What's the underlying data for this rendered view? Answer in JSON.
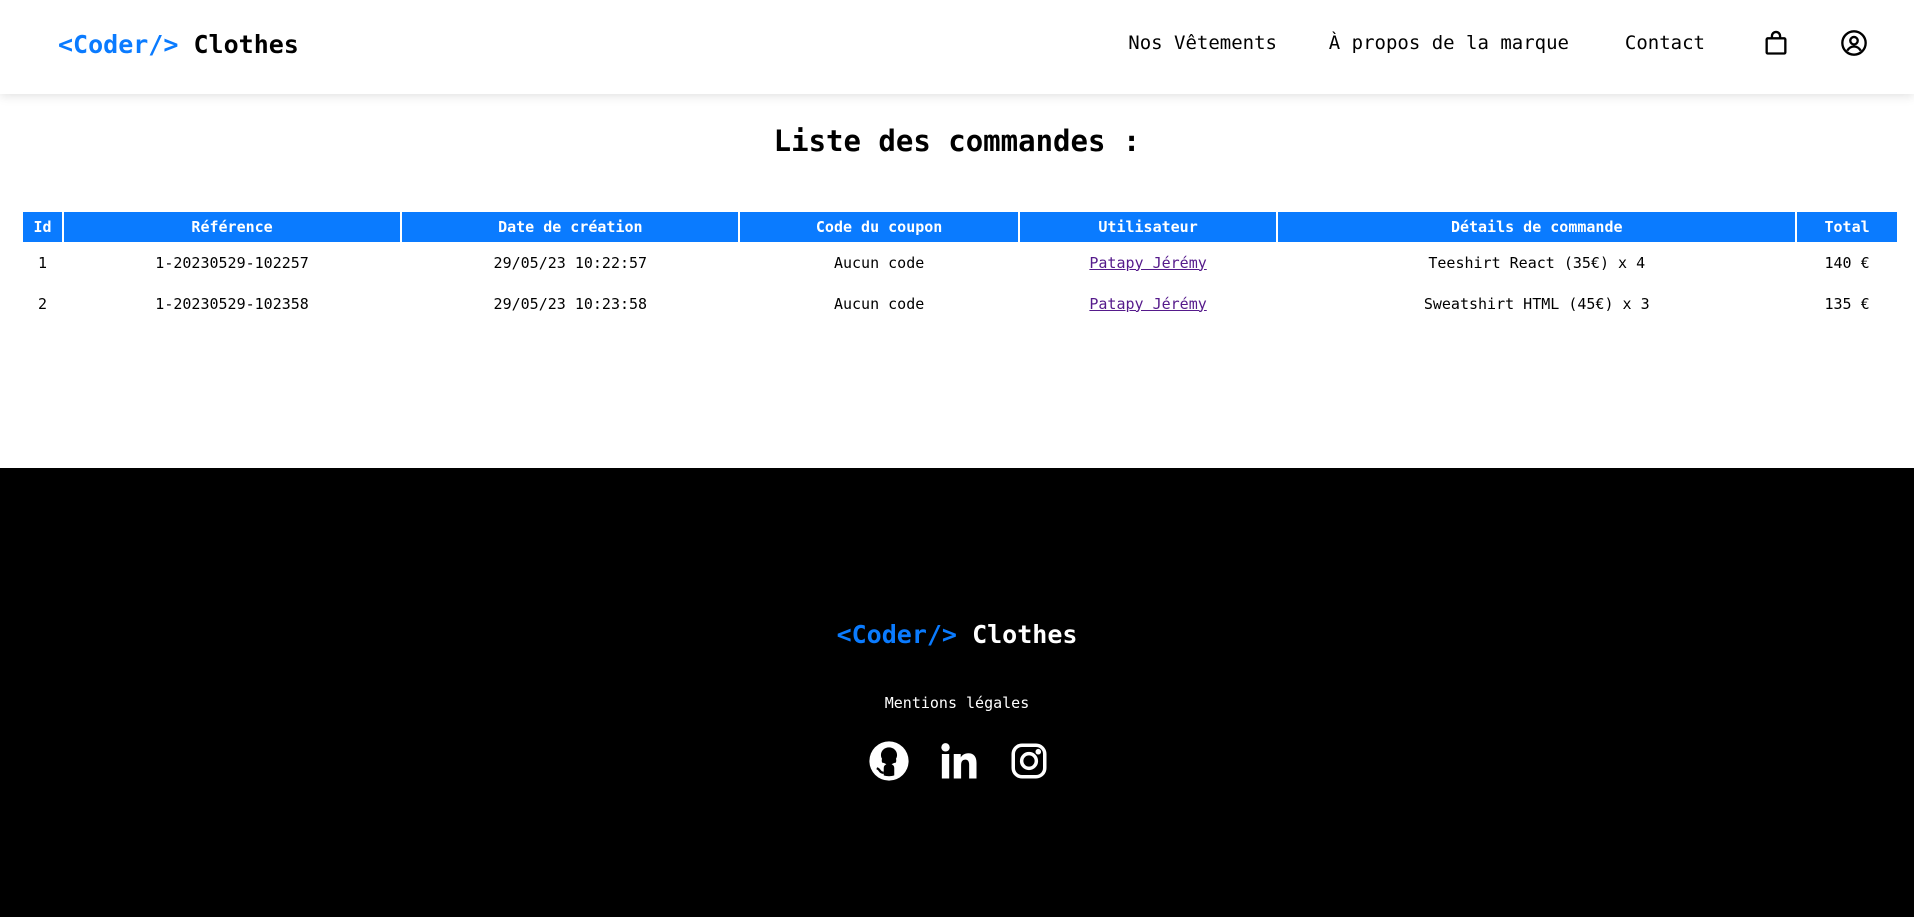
{
  "header": {
    "logo_code": "<Coder/>",
    "logo_rest": "Clothes",
    "nav": {
      "clothes": "Nos Vêtements",
      "about": "À propos de la marque",
      "contact": "Contact"
    },
    "icons": [
      "shopping-bag-icon",
      "user-circle-icon"
    ]
  },
  "main": {
    "title": "Liste des commandes :",
    "table": {
      "headers": [
        "Id",
        "Référence",
        "Date de création",
        "Code du coupon",
        "Utilisateur",
        "Détails de commande",
        "Total"
      ],
      "rows": [
        {
          "id": "1",
          "reference": "1-20230529-102257",
          "date": "29/05/23 10:22:57",
          "coupon": "Aucun code",
          "user": "Patapy Jérémy",
          "details": "Teeshirt React (35€) x 4",
          "total": "140 €"
        },
        {
          "id": "2",
          "reference": "1-20230529-102358",
          "date": "29/05/23 10:23:58",
          "coupon": "Aucun code",
          "user": "Patapy Jérémy",
          "details": "Sweatshirt HTML (45€) x 3",
          "total": "135 €"
        }
      ]
    }
  },
  "footer": {
    "logo_code": "<Coder/>",
    "logo_rest": "Clothes",
    "legal": "Mentions légales",
    "socials": [
      "github-icon",
      "linkedin-icon",
      "instagram-icon"
    ]
  },
  "colors": {
    "accent": "#0a7bff",
    "footer_bg": "#000000",
    "visited_link": "#551a8b"
  }
}
